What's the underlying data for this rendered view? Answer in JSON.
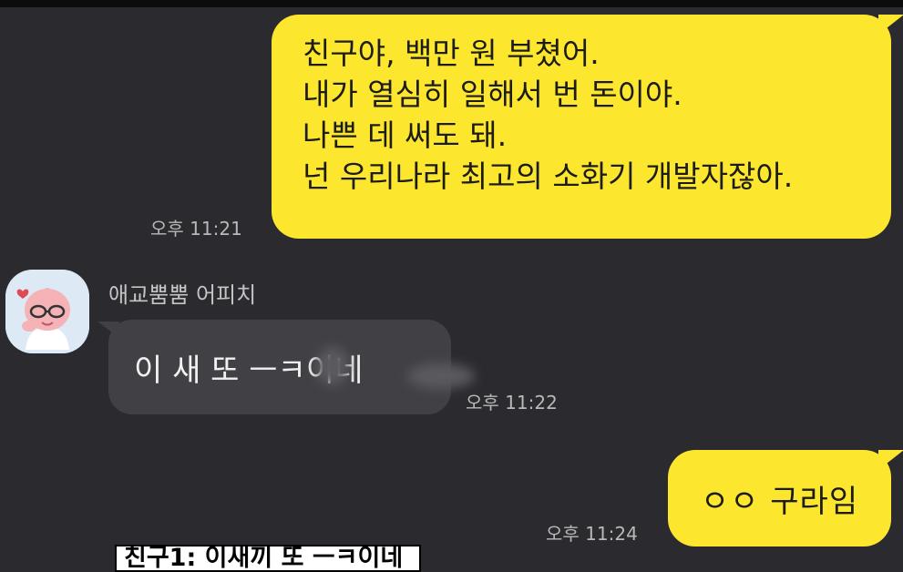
{
  "messages": {
    "outgoing_1": {
      "lines": [
        "친구야, 백만 원 부쳤어.",
        "내가 열심히 일해서 번 돈이야.",
        "나쁜 데 써도 돼.",
        "넌 우리나라 최고의 소화기 개발자잖아."
      ],
      "time": "오후 11:21"
    },
    "incoming_1": {
      "sender": "애교뿜뿜 어피치",
      "text": "이 새  또 ㅡㅋ이네",
      "time": "오후 11:22"
    },
    "outgoing_2": {
      "text": "ㅇㅇ 구라임",
      "time": "오후 11:24"
    }
  },
  "caption": {
    "text": "친구1: 이새끼 또 ㅡㅋ이네"
  },
  "colors": {
    "background": "#2b2b2f",
    "outgoing_bubble": "#fde72e",
    "incoming_bubble": "#414145",
    "timestamp": "#b8b8b8"
  },
  "icons": {
    "avatar": "apeach-avatar-icon"
  }
}
